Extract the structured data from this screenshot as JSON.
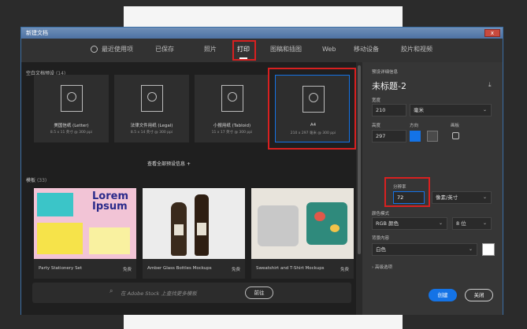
{
  "window": {
    "title": "新建文档",
    "close_label": "x"
  },
  "tabs": [
    {
      "label": "最近使用项",
      "icon": "clock-icon"
    },
    {
      "label": "已保存"
    },
    {
      "label": "照片"
    },
    {
      "label": "打印"
    },
    {
      "label": "图稿和插图"
    },
    {
      "label": "Web"
    },
    {
      "label": "移动设备"
    },
    {
      "label": "胶片和视频"
    }
  ],
  "presets": {
    "section_label": "空白文档预设",
    "count": "(14)",
    "items": [
      {
        "name": "美国信纸 (Letter)",
        "size": "8.5 x 11 英寸 @ 300 ppi"
      },
      {
        "name": "法律文件用纸 (Legal)",
        "size": "8.5 x 14 英寸 @ 300 ppi"
      },
      {
        "name": "小报用纸 (Tabloid)",
        "size": "11 x 17 英寸 @ 300 ppi"
      },
      {
        "name": "A4",
        "size": "210 x 297 毫米 @ 300 ppi"
      }
    ],
    "view_all": "查看全部预设信息",
    "view_all_icon": "plus-icon"
  },
  "templates": {
    "section_label": "模板",
    "count": "(33)",
    "items": [
      {
        "name": "Party Stationery Set",
        "badge": "免费",
        "heading1": "Lorem",
        "heading2": "Ipsum"
      },
      {
        "name": "Amber Glass Bottles Mockups",
        "badge": "免费"
      },
      {
        "name": "Sweatshirt and T-Shirt Mockups",
        "badge": "免费"
      }
    ]
  },
  "search": {
    "placeholder": "在 Adobe Stock 上查找更多模板",
    "go_label": "前往",
    "icon": "search-icon"
  },
  "details": {
    "section_label": "预设详细信息",
    "doc_name": "未标题-2",
    "save_icon": "save-preset-icon",
    "width_label": "宽度",
    "width_value": "210",
    "width_unit": "毫米",
    "height_label": "高度",
    "height_value": "297",
    "orientation_label": "方向",
    "artboard_label": "画板",
    "resolution_label": "分辨率",
    "resolution_value": "72",
    "resolution_unit": "像素/英寸",
    "color_mode_label": "颜色模式",
    "color_mode_value": "RGB 颜色",
    "bit_depth_value": "8 位",
    "background_label": "背景内容",
    "background_value": "白色",
    "background_color": "#ffffff",
    "advanced_label": "高级选项",
    "create_label": "创建",
    "close_label": "关闭"
  },
  "colors": {
    "accent": "#1473e6",
    "highlight": "#d82020"
  }
}
